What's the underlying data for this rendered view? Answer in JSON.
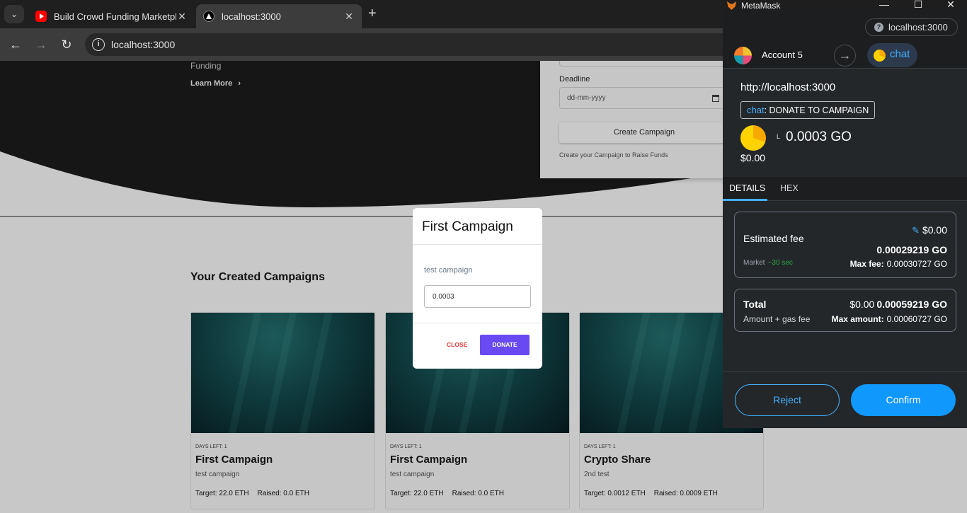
{
  "browser": {
    "tabs": [
      {
        "title": "Build Crowd Funding Marketplace",
        "active": false
      },
      {
        "title": "localhost:3000",
        "active": true
      }
    ],
    "new_tab": "+",
    "url": "localhost:3000"
  },
  "hero": {
    "funding_text": "Funding",
    "learn_more": "Learn More"
  },
  "create_form": {
    "deadline_label": "Deadline",
    "deadline_placeholder": "dd-mm-yyyy",
    "create_button": "Create Campaign",
    "hint": "Create your Campaign to Raise Funds"
  },
  "campaigns_section": {
    "title": "Your Created Campaigns",
    "cards": [
      {
        "days_left": "DAYS LEFT: 1",
        "title": "First Campaign",
        "description": "test campaign",
        "target": "Target: 22.0 ETH",
        "raised": "Raised: 0.0 ETH"
      },
      {
        "days_left": "DAYS LEFT: 1",
        "title": "First Campaign",
        "description": "test campaign",
        "target": "Target: 22.0 ETH",
        "raised": "Raised: 0.0 ETH"
      },
      {
        "days_left": "DAYS LEFT: 1",
        "title": "Crypto Share",
        "description": "2nd test",
        "target": "Target: 0.0012 ETH",
        "raised": "Raised: 0.0009 ETH"
      }
    ]
  },
  "donate_modal": {
    "title": "First Campaign",
    "description": "test campaign",
    "amount_value": "0.0003",
    "close_label": "CLOSE",
    "donate_label": "DONATE"
  },
  "metamask": {
    "window_title": "MetaMask",
    "site_chip": "localhost:3000",
    "account_name": "Account 5",
    "network_chip": "chat",
    "origin": "http://localhost:3000",
    "method_prefix": "chat",
    "method_name": ": DONATE TO CAMPAIGN",
    "token_letter": "L",
    "amount": "0.0003 GO",
    "amount_fiat": "$0.00",
    "tabs": {
      "details": "DETAILS",
      "hex": "HEX"
    },
    "estimated_fee": {
      "label": "Estimated fee",
      "fiat": "$0.00",
      "native": "0.00029219 GO",
      "market": "Market",
      "time": "~30 sec",
      "max_fee_label": "Max fee:",
      "max_fee_value": "0.00030727 GO"
    },
    "total": {
      "label": "Total",
      "fiat": "$0.00",
      "native": "0.00059219 GO",
      "sub_label": "Amount + gas fee",
      "max_amount_label": "Max amount:",
      "max_amount_value": "0.00060727 GO"
    },
    "reject_label": "Reject",
    "confirm_label": "Confirm",
    "colors": {
      "accent": "#1098fc",
      "background": "#24272a"
    }
  }
}
